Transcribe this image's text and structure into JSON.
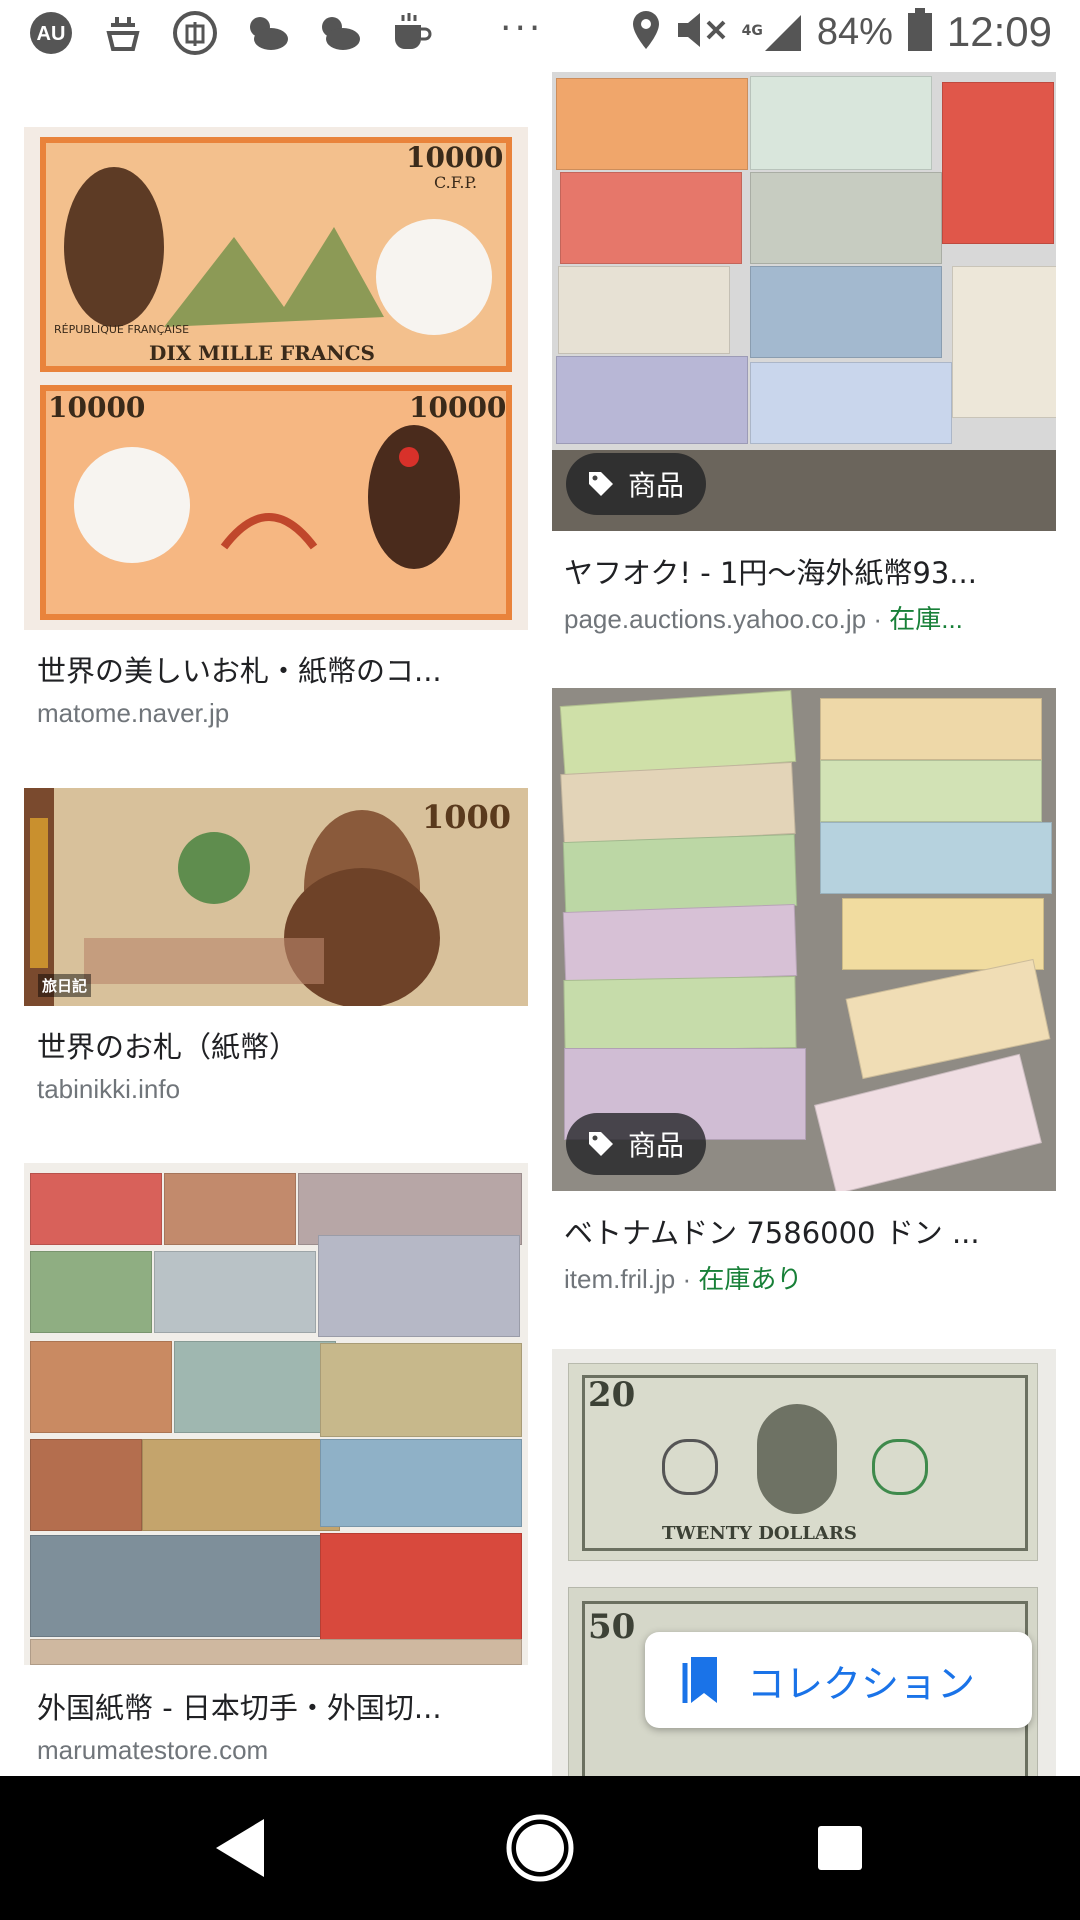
{
  "status_bar": {
    "icons": [
      "app-logo-icon",
      "broom-icon",
      "kanji-circle-icon",
      "cloudy-icon",
      "cloudy-icon",
      "coffee-icon"
    ],
    "more": "···",
    "network": "4G",
    "battery_percent": "84%",
    "time": "12:09"
  },
  "results": [
    {
      "title": "世界の美しいお札・紙幣のコ...",
      "source": "matome.naver.jp",
      "stock": "",
      "badge": ""
    },
    {
      "title": "ヤフオク! - 1円～海外紙幣93...",
      "source": "page.auctions.yahoo.co.jp",
      "stock": "在庫...",
      "badge": "商品"
    },
    {
      "title": "世界のお札（紙幣）",
      "source": "tabinikki.info",
      "stock": "",
      "badge": ""
    },
    {
      "title": "ベトナムドン 7586000 ドン ...",
      "source": "item.fril.jp",
      "stock": "在庫あり",
      "badge": "商品"
    },
    {
      "title": "外国紙幣 - 日本切手・外国切...",
      "source": "marumatestore.com",
      "stock": "",
      "badge": ""
    }
  ],
  "images": {
    "cfp": {
      "value": "10000",
      "sub": "C.F.P.",
      "caption": "DIX MILLE FRANCS",
      "country": "RÉPUBLIQUE FRANÇAISE"
    },
    "thai": {
      "value": "1000",
      "watermark": "旅日記"
    },
    "usd": {
      "value_top": "20",
      "caption_top": "TWENTY DOLLARS",
      "value_bottom": "50"
    }
  },
  "stock_separator": " · ",
  "collection_button": {
    "label": "コレクション"
  },
  "nav": [
    "back-button",
    "home-button",
    "recents-button"
  ],
  "colors": {
    "accent": "#1a73e8",
    "stock_green": "#188038",
    "source_gray": "#70757a"
  }
}
